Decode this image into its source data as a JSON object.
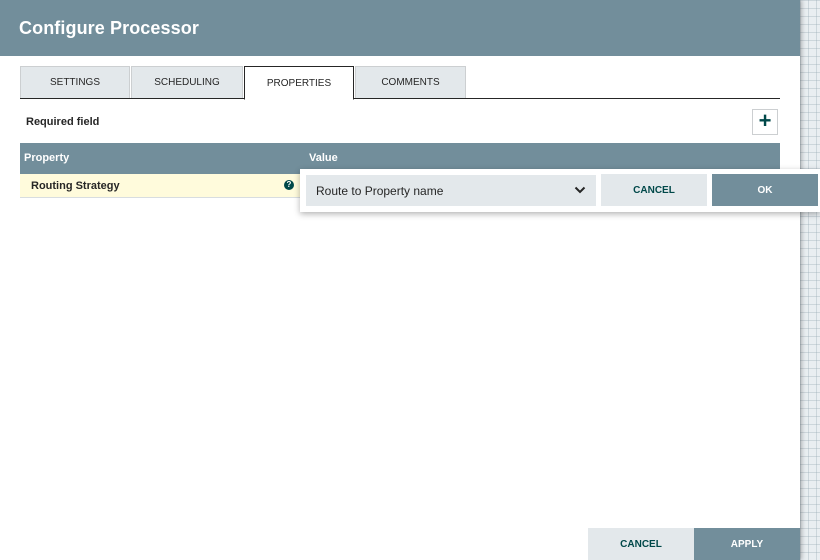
{
  "dialog": {
    "title": "Configure Processor"
  },
  "tabs": [
    {
      "label": "SETTINGS",
      "active": false
    },
    {
      "label": "SCHEDULING",
      "active": false
    },
    {
      "label": "PROPERTIES",
      "active": true
    },
    {
      "label": "COMMENTS",
      "active": false
    }
  ],
  "properties": {
    "required_label": "Required field",
    "add_icon": "plus-icon",
    "columns": [
      "Property",
      "Value"
    ],
    "rows": [
      {
        "name": "Routing Strategy",
        "help_icon": "question-icon"
      }
    ]
  },
  "editor": {
    "selected_value": "Route to Property name",
    "chevron_icon": "chevron-down-icon",
    "cancel_label": "CANCEL",
    "ok_label": "OK"
  },
  "footer": {
    "cancel_label": "CANCEL",
    "apply_label": "APPLY"
  },
  "colors": {
    "header": "#728e9b",
    "tab_inactive": "#e3e8eb",
    "required_row": "#fffbdc",
    "accent_dark": "#004849"
  }
}
